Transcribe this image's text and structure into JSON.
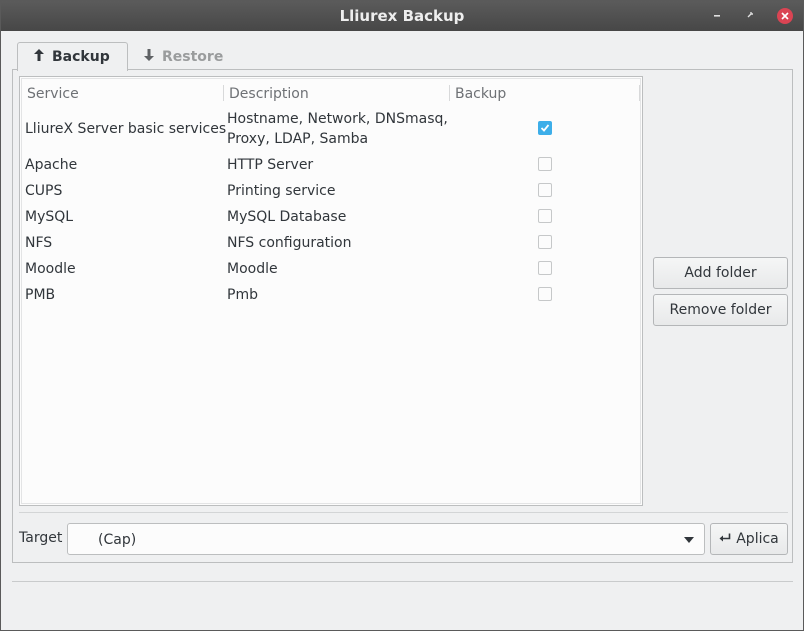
{
  "window": {
    "title": "Lliurex Backup"
  },
  "tabs": [
    {
      "label": "Backup",
      "active": true,
      "icon": "arrow-up-icon"
    },
    {
      "label": "Restore",
      "active": false,
      "icon": "arrow-down-icon"
    }
  ],
  "table": {
    "columns": [
      "Service",
      "Description",
      "Backup"
    ],
    "rows": [
      {
        "service": "LliureX Server basic services",
        "description_line1": "Hostname, Network, DNSmasq,",
        "description_line2": "Proxy, LDAP, Samba",
        "backup": true
      },
      {
        "service": "Apache",
        "description_line1": "HTTP Server",
        "backup": false
      },
      {
        "service": "CUPS",
        "description_line1": "Printing service",
        "backup": false
      },
      {
        "service": "MySQL",
        "description_line1": "MySQL Database",
        "backup": false
      },
      {
        "service": "NFS",
        "description_line1": "NFS configuration",
        "backup": false
      },
      {
        "service": "Moodle",
        "description_line1": "Moodle",
        "backup": false
      },
      {
        "service": "PMB",
        "description_line1": "Pmb",
        "backup": false
      }
    ]
  },
  "side_buttons": {
    "add_folder": "Add folder",
    "remove_folder": "Remove folder"
  },
  "target": {
    "label": "Target",
    "value": "(Cap)",
    "apply_label": "Aplica"
  },
  "colors": {
    "accent": "#3daee9",
    "close": "#da4453",
    "titlebar": "#4f4f4f"
  }
}
